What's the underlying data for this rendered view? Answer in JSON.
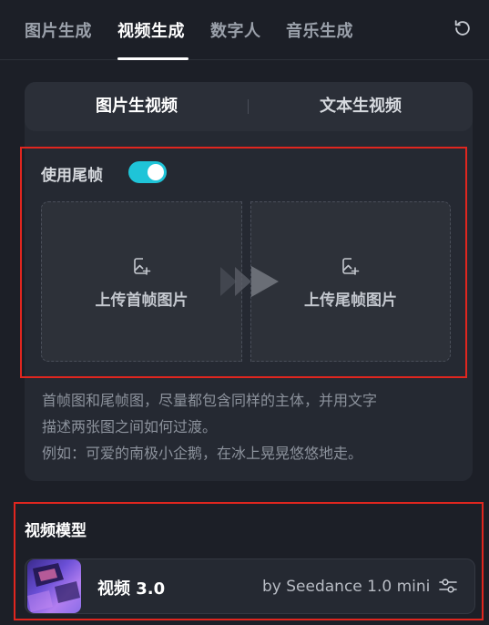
{
  "tabs": [
    {
      "label": "图片生成"
    },
    {
      "label": "视频生成",
      "active": true
    },
    {
      "label": "数字人"
    },
    {
      "label": "音乐生成"
    }
  ],
  "mode_switch": {
    "left": "图片生视频",
    "right": "文本生视频",
    "selected": "图片生视频"
  },
  "end_frame": {
    "toggle_label": "使用尾帧",
    "enabled": true,
    "first_upload": "上传首帧图片",
    "last_upload": "上传尾帧图片"
  },
  "hint": {
    "line1": "首帧图和尾帧图，尽量都包含同样的主体，并用文字",
    "line2": "描述两张图之间如何过渡。",
    "line3": "例如：可爱的南极小企鹅，在冰上晃晃悠悠地走。"
  },
  "model_section": {
    "title": "视频模型",
    "name": "视频 3.0",
    "subtitle": "by Seedance 1.0 mini"
  },
  "colors": {
    "accent": "#1fc4d8",
    "highlight_border": "#e0261f",
    "background": "#1c1f27"
  },
  "icons": [
    "refresh-icon",
    "image-add-icon",
    "forward-arrows-icon",
    "sliders-icon"
  ]
}
